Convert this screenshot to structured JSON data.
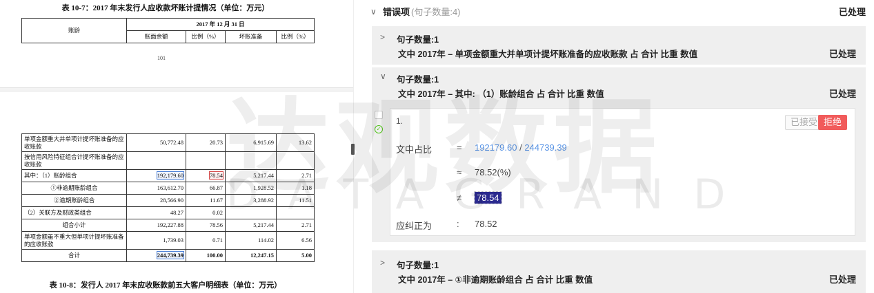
{
  "document": {
    "table1_title": "表 10-7：2017 年末发行人应收款坏账计提情况（单位：万元）",
    "header": {
      "age_label": "账龄",
      "date_label": "2017 年 12 月 31 日",
      "col_balance": "账面余额",
      "col_ratio1": "比例（%）",
      "col_provision": "坏账准备",
      "col_ratio2": "比例（%）"
    },
    "page_number": "101",
    "rows": [
      {
        "name": "单项金额重大并单项计提坏账准备的应收账款",
        "balance": "50,772.48",
        "ratio": "20.73",
        "provision": "6,915.69",
        "ratio2": "13.62"
      },
      {
        "name": "按信用风险特征组合计提坏账准备的应收账款",
        "balance": "",
        "ratio": "",
        "provision": "",
        "ratio2": ""
      },
      {
        "name": "其中：（1）账龄组合",
        "balance": "192,179.60",
        "ratio": "78.54",
        "provision": "5,217.44",
        "ratio2": "2.71"
      },
      {
        "name": "①非逾期账龄组合",
        "balance": "163,612.70",
        "ratio": "66.87",
        "provision": "1,928.52",
        "ratio2": "1.18"
      },
      {
        "name": "②逾期账龄组合",
        "balance": "28,566.90",
        "ratio": "11.67",
        "provision": "3,288.92",
        "ratio2": "11.51"
      },
      {
        "name": "（2）关联方及财政类组合",
        "balance": "48.27",
        "ratio": "0.02",
        "provision": "",
        "ratio2": ""
      },
      {
        "name": "组合小计",
        "balance": "192,227.88",
        "ratio": "78.56",
        "provision": "5,217.44",
        "ratio2": "2.71"
      },
      {
        "name": "单项金额虽不重大但单项计提坏账准备的应收账款",
        "balance": "1,739.03",
        "ratio": "0.71",
        "provision": "114.02",
        "ratio2": "6.56"
      },
      {
        "name": "合计",
        "balance": "244,739.39",
        "ratio": "100.00",
        "provision": "12,247.15",
        "ratio2": "5.00"
      }
    ],
    "table2_title": "表 10-8：发行人 2017 年末应收账款前五大客户明细表（单位：万元）"
  },
  "panel": {
    "section_title": "错误项",
    "section_count": "(句子数量:4)",
    "section_status": "已处理",
    "cards": [
      {
        "count": "句子数量:1",
        "sentence": "文中 2017年 – 单项金额重大并单项计提坏账准备的应收账款 占 合计 比重 数值",
        "status": "已处理"
      },
      {
        "count": "句子数量:1",
        "sentence": "文中 2017年 – 其中: （1）账龄组合 占 合计 比重 数值",
        "status": "已处理"
      },
      {
        "count": "句子数量:1",
        "sentence": "文中 2017年 – ①非逾期账龄组合 占 合计 比重 数值",
        "status": "已处理"
      }
    ],
    "detail": {
      "index": "1.",
      "accept_label": "已接受",
      "reject_label": "拒绝",
      "ratio_label": "文中占比",
      "eq": "=",
      "numerator": "192179.60",
      "slash": "/",
      "denominator": "244739.39",
      "approx": "≈",
      "computed": "78.52(%)",
      "neq": "≠",
      "found": "78.54",
      "correct_label": "应纠正为",
      "colon": ":",
      "correct_value": "78.52"
    }
  },
  "watermark": {
    "cn": "达观数据",
    "en": "DATAGRAND"
  }
}
